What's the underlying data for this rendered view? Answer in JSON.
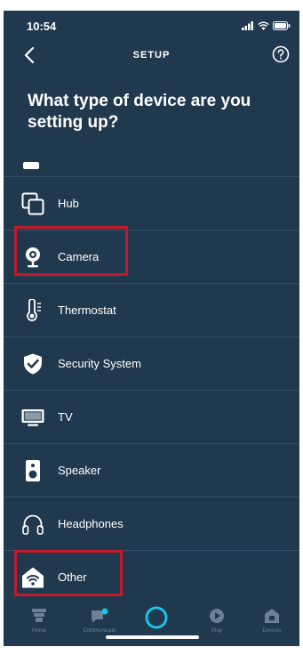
{
  "status": {
    "time": "10:54"
  },
  "header": {
    "title": "SETUP"
  },
  "heading": "What type of device are you setting up?",
  "devices": [
    {
      "label": "Hub",
      "icon": "hub-icon"
    },
    {
      "label": "Camera",
      "icon": "camera-icon",
      "highlighted": true
    },
    {
      "label": "Thermostat",
      "icon": "thermostat-icon"
    },
    {
      "label": "Security System",
      "icon": "shield-icon"
    },
    {
      "label": "TV",
      "icon": "tv-icon"
    },
    {
      "label": "Speaker",
      "icon": "speaker-icon"
    },
    {
      "label": "Headphones",
      "icon": "headphones-icon"
    },
    {
      "label": "Other",
      "icon": "wifi-house-icon",
      "highlighted": true
    }
  ],
  "tabs": [
    {
      "label": "Home",
      "icon": "home-icon"
    },
    {
      "label": "Communicate",
      "icon": "chat-icon"
    },
    {
      "label": "",
      "icon": "alexa-icon"
    },
    {
      "label": "Play",
      "icon": "play-icon"
    },
    {
      "label": "Devices",
      "icon": "devices-icon"
    }
  ],
  "colors": {
    "background": "#21394f",
    "highlight": "#c21a2a",
    "alexa_ring": "#1bc2e8",
    "inactive_tab": "#6d8194"
  }
}
